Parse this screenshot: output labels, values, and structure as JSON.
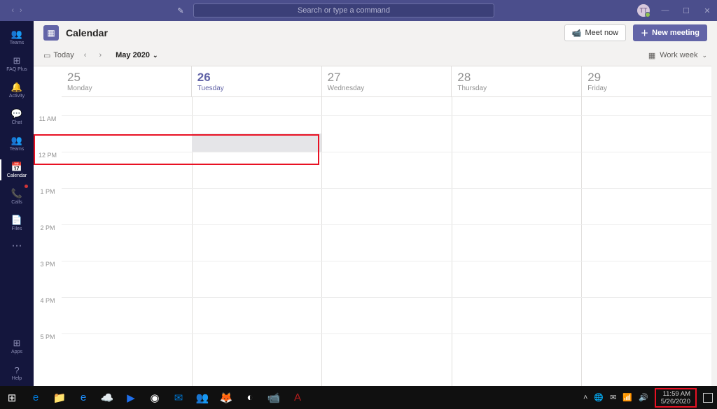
{
  "titlebar": {
    "search_placeholder": "Search or type a command",
    "avatar_initials": "TT"
  },
  "rail": {
    "items": [
      {
        "label": "Teams",
        "icon": "👥"
      },
      {
        "label": "FAQ Plus",
        "icon": "⊞"
      },
      {
        "label": "Activity",
        "icon": "🔔",
        "badge": true
      },
      {
        "label": "Chat",
        "icon": "💬"
      },
      {
        "label": "Teams",
        "icon": "👥"
      },
      {
        "label": "Calendar",
        "icon": "📅",
        "active": true
      },
      {
        "label": "Calls",
        "icon": "📞",
        "badge": true
      },
      {
        "label": "Files",
        "icon": "📄"
      }
    ],
    "more": "⋯",
    "apps": {
      "label": "Apps",
      "icon": "⊞"
    },
    "help": {
      "label": "Help",
      "icon": "?"
    }
  },
  "header": {
    "title": "Calendar",
    "meet_now": "Meet now",
    "new_meeting": "New meeting"
  },
  "toolbar": {
    "today": "Today",
    "month": "May 2020",
    "view": "Work week"
  },
  "calendar": {
    "days": [
      {
        "num": "25",
        "name": "Monday"
      },
      {
        "num": "26",
        "name": "Tuesday",
        "today": true
      },
      {
        "num": "27",
        "name": "Wednesday"
      },
      {
        "num": "28",
        "name": "Thursday"
      },
      {
        "num": "29",
        "name": "Friday"
      }
    ],
    "hours": [
      "11 AM",
      "12 PM",
      "1 PM",
      "2 PM",
      "3 PM",
      "4 PM",
      "5 PM"
    ]
  },
  "taskbar": {
    "time": "11:59 AM",
    "date": "5/26/2020"
  }
}
